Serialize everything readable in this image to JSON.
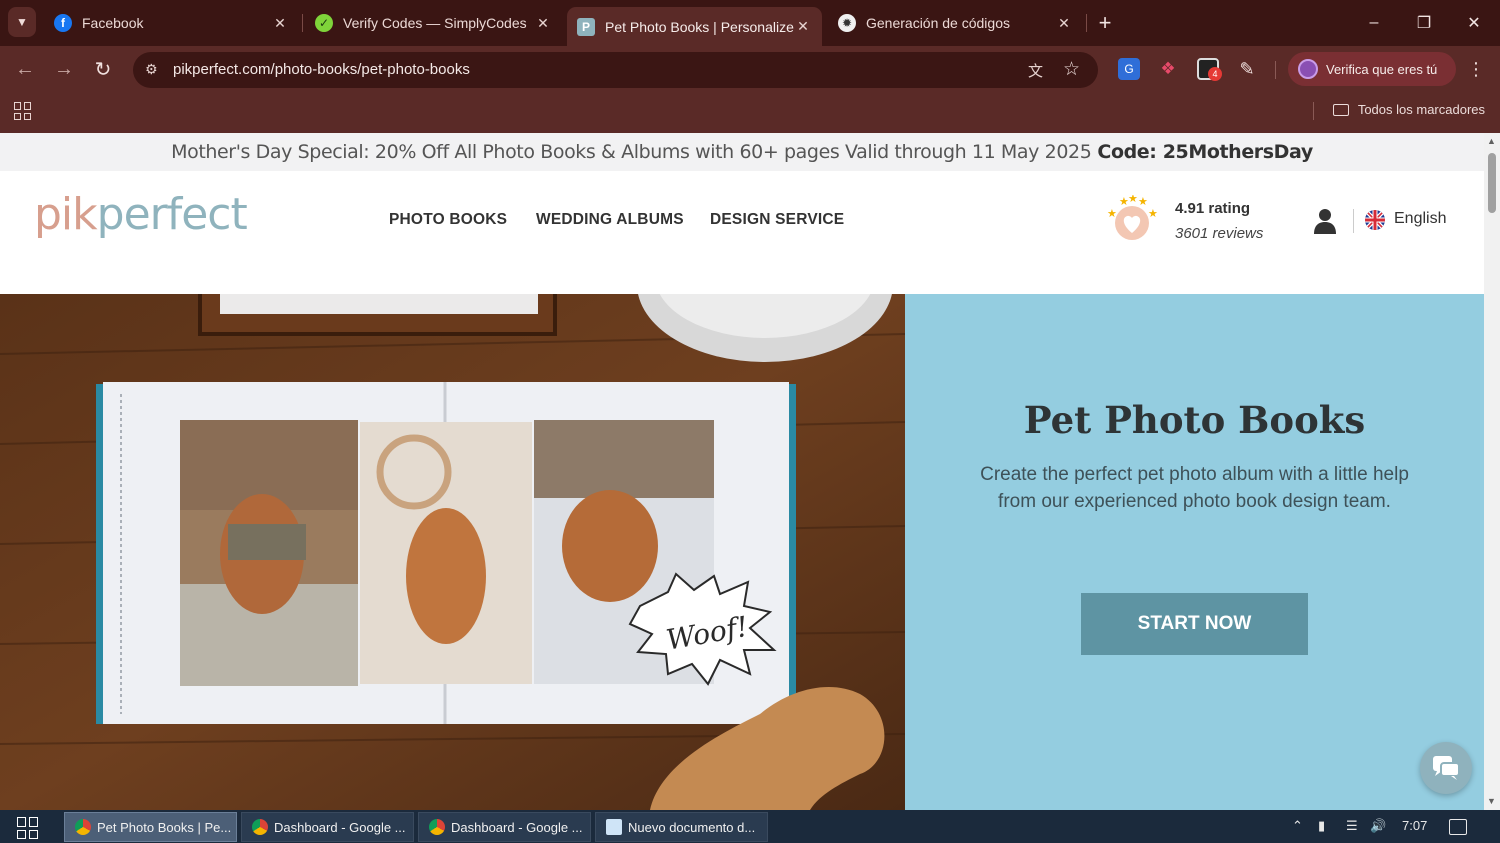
{
  "browser": {
    "tabs": [
      {
        "title": "Facebook",
        "icon": "facebook-icon"
      },
      {
        "title": "Verify Codes — SimplyCodes",
        "icon": "simplycodes-icon"
      },
      {
        "title": "Pet Photo Books | Personalized",
        "icon": "pikperfect-icon",
        "active": true
      },
      {
        "title": "Generación de códigos",
        "icon": "openai-icon"
      }
    ],
    "url": "pikperfect.com/photo-books/pet-photo-books",
    "profile_label": "Verifica que eres tú",
    "bookmarks_label": "Todos los marcadores",
    "extension_badge": "4",
    "colors": {
      "frame": "#3a1513",
      "toolbar": "#5a2a27",
      "omnibox": "#3b1614",
      "profile": "#7a2f33"
    }
  },
  "promo": {
    "text": "Mother's Day Special: 20% Off All Photo Books & Albums with 60+ pages Valid through 11 May 2025",
    "code": "Code: 25MothersDay"
  },
  "header": {
    "logo_a": "pik",
    "logo_b": "perfect",
    "nav": [
      "PHOTO BOOKS",
      "WEDDING ALBUMS",
      "DESIGN SERVICE"
    ],
    "rating": "4.91 rating",
    "reviews": "3601 reviews",
    "language": "English"
  },
  "hero": {
    "title": "Pet Photo Books",
    "text": "Create the perfect pet photo album with a little help from our experienced photo book design team.",
    "cta": "START NOW",
    "album_caption": "Woof!",
    "panel_color": "#94cde0",
    "cta_color": "#5e94a3"
  },
  "taskbar": {
    "items": [
      {
        "title": "Pet Photo Books | Pe...",
        "active": true
      },
      {
        "title": "Dashboard - Google ..."
      },
      {
        "title": "Dashboard - Google ..."
      },
      {
        "title": "Nuevo documento d..."
      }
    ],
    "clock": "7:07"
  }
}
